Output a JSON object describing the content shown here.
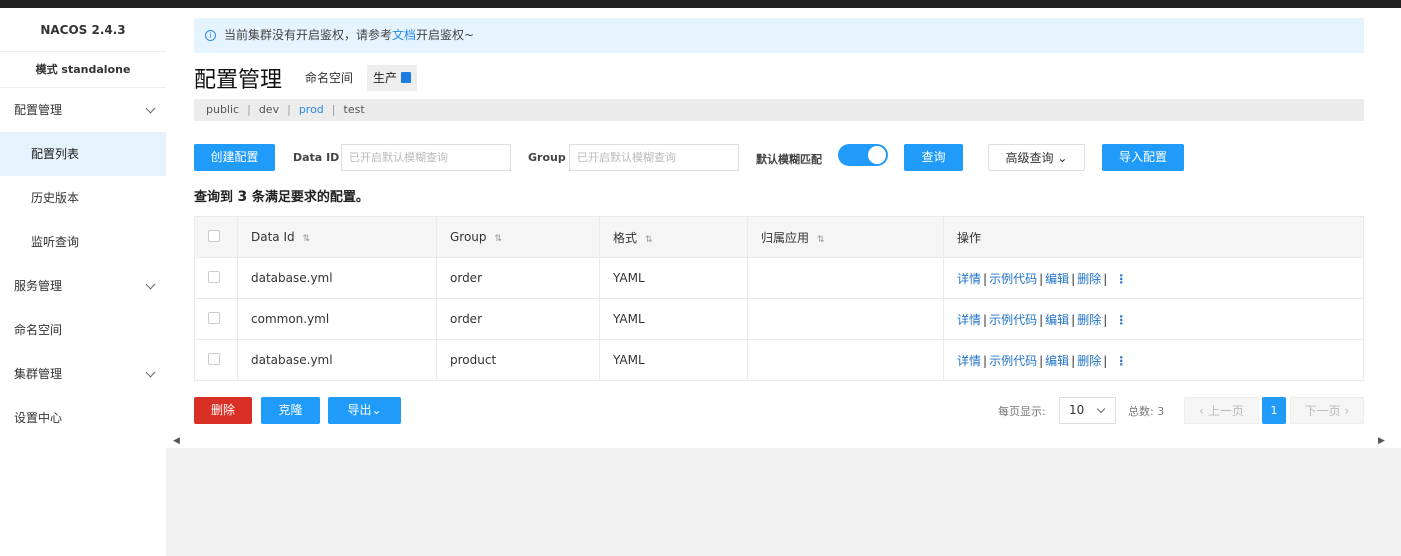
{
  "sidebar": {
    "title": "NACOS 2.4.3",
    "mode": "模式 standalone",
    "groups": [
      {
        "label": "配置管理",
        "items": [
          "配置列表",
          "历史版本",
          "监听查询"
        ]
      },
      {
        "label": "服务管理"
      },
      {
        "label": "命名空间"
      },
      {
        "label": "集群管理"
      },
      {
        "label": "设置中心"
      }
    ]
  },
  "banner": {
    "icon": "i",
    "text_before": "当前集群没有开启鉴权，请参考",
    "link": "文档",
    "text_after": "开启鉴权~"
  },
  "header": {
    "title": "配置管理",
    "ns_label": "命名空间",
    "ns_current": "生产"
  },
  "namespaces": [
    "public",
    "dev",
    "prod",
    "test"
  ],
  "namespace_separator": "|",
  "toolbar": {
    "create": "创建配置",
    "dataid_label": "Data ID",
    "dataid_placeholder": "已开启默认模糊查询",
    "group_label": "Group",
    "group_placeholder": "已开启默认模糊查询",
    "fuzzy_label": "默认模糊匹配",
    "query": "查询",
    "advanced": "高级查询",
    "advanced_arrow": "⌄",
    "import": "导入配置"
  },
  "result": {
    "prefix": "查询到",
    "count": "3",
    "suffix": "条满足要求的配置。"
  },
  "table": {
    "columns": [
      "Data Id",
      "Group",
      "格式",
      "归属应用",
      "操作"
    ],
    "sort_icon": "⇅",
    "rows": [
      {
        "data_id": "database.yml",
        "group": "order",
        "format": "YAML",
        "app": ""
      },
      {
        "data_id": "common.yml",
        "group": "order",
        "format": "YAML",
        "app": ""
      },
      {
        "data_id": "database.yml",
        "group": "product",
        "format": "YAML",
        "app": ""
      }
    ],
    "actions": [
      "详情",
      "示例代码",
      "编辑",
      "删除"
    ],
    "action_separator": "|",
    "more_icon": "⋮"
  },
  "bottom": {
    "delete": "删除",
    "clone": "克隆",
    "export": "导出",
    "export_arrow": "⌄"
  },
  "pager": {
    "page_size_label": "每页显示:",
    "page_size": "10",
    "total_label": "总数:",
    "total": "3",
    "prev": "上一页",
    "prev_arrow": "‹",
    "current": "1",
    "next": "下一页",
    "next_arrow": "›"
  },
  "scroll": {
    "left": "◀",
    "right": "▶"
  }
}
